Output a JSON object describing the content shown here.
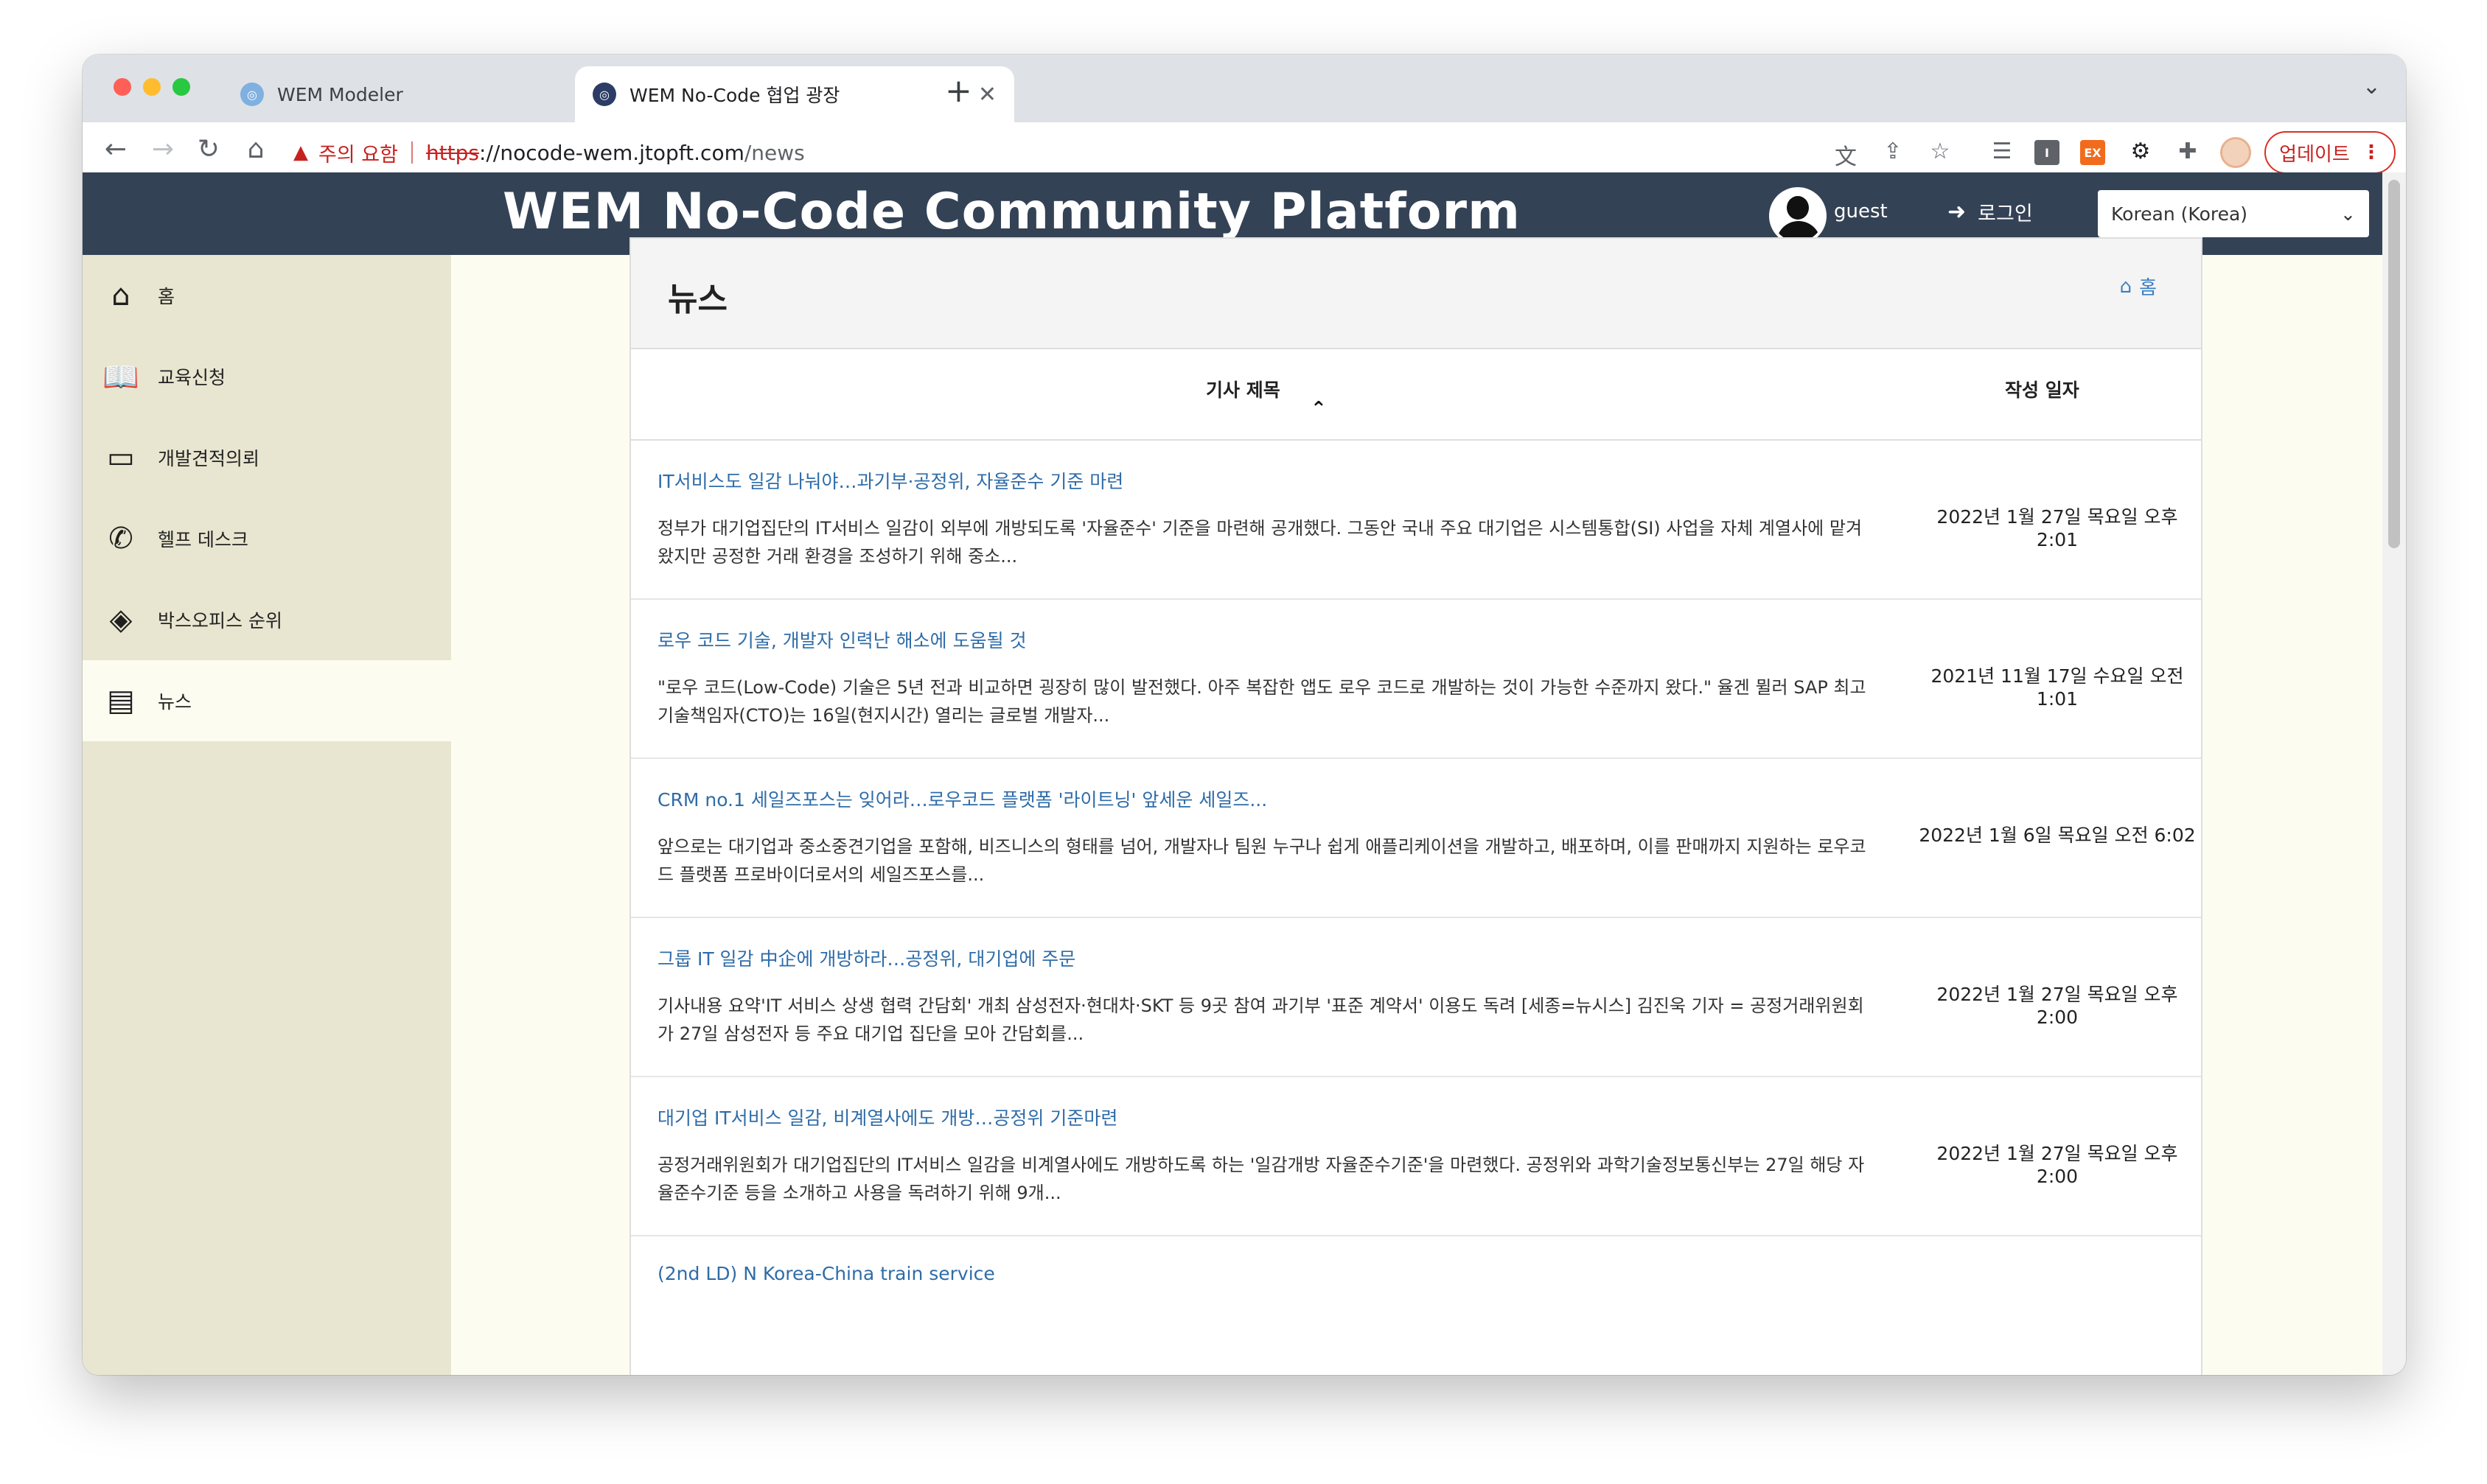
{
  "browser": {
    "tabs": [
      {
        "title": "WEM Modeler",
        "active": false
      },
      {
        "title": "WEM No-Code 협업 광장",
        "active": true
      }
    ],
    "new_tab": "+",
    "tab_menu": "⌄",
    "security_warning": "주의 요함",
    "url": {
      "scheme": "https",
      "host": "://nocode-wem.jtopft.com",
      "path": "/news"
    },
    "update_button": "업데이트",
    "menu_dots": "⋮",
    "extension_labels": {
      "ext1": "I",
      "ext2": "EX"
    }
  },
  "site": {
    "title": "WEM No-Code Community Platform",
    "user_name": "guest",
    "login_label": "로그인",
    "language": "Korean (Korea)"
  },
  "sidebar": {
    "items": [
      {
        "label": "홈",
        "icon": "home-icon"
      },
      {
        "label": "교육신청",
        "icon": "book-icon"
      },
      {
        "label": "개발견적의뢰",
        "icon": "monitor-icon"
      },
      {
        "label": "헬프 데스크",
        "icon": "phone-icon"
      },
      {
        "label": "박스오피스 순위",
        "icon": "ticket-icon"
      },
      {
        "label": "뉴스",
        "icon": "newspaper-icon",
        "active": true
      }
    ]
  },
  "news": {
    "title": "뉴스",
    "breadcrumb": "홈",
    "columns": {
      "title": "기사 제목",
      "date": "작성 일자"
    },
    "rows": [
      {
        "title": "IT서비스도 일감 나눠야…과기부·공정위, 자율준수 기준 마련",
        "summary": "정부가 대기업집단의 IT서비스 일감이 외부에 개방되도록 '자율준수' 기준을 마련해 공개했다. 그동안 국내 주요 대기업은 시스템통합(SI) 사업을 자체 계열사에 맡겨왔지만 공정한 거래 환경을 조성하기 위해 중소...",
        "date": "2022년 1월 27일 목요일 오후 2:01"
      },
      {
        "title": "로우 코드 기술, 개발자 인력난 해소에 도움될 것",
        "summary": "\"로우 코드(Low-Code) 기술은 5년 전과 비교하면 굉장히 많이 발전했다. 아주 복잡한 앱도 로우 코드로 개발하는 것이 가능한 수준까지 왔다.\" 율겐 뮐러 SAP 최고기술책임자(CTO)는 16일(현지시간) 열리는 글로벌 개발자...",
        "date": "2021년 11월 17일 수요일 오전 1:01"
      },
      {
        "title": "CRM no.1 세일즈포스는 잊어라…로우코드 플랫폼 '라이트닝' 앞세운 세일즈...",
        "summary": "앞으로는 대기업과 중소중견기업을 포함해, 비즈니스의 형태를 넘어, 개발자나 팀원 누구나 쉽게 애플리케이션을 개발하고, 배포하며, 이를 판매까지 지원하는 로우코드 플랫폼 프로바이더로서의 세일즈포스를...",
        "date": "2022년 1월 6일 목요일 오전 6:02"
      },
      {
        "title": "그룹 IT 일감 中企에 개방하라…공정위, 대기업에 주문",
        "summary": "기사내용 요약'IT 서비스 상생 협력 간담회' 개최 삼성전자·현대차·SKT 등 9곳 참여 과기부 '표준 계약서' 이용도 독려 [세종=뉴시스] 김진욱 기자 = 공정거래위원회가 27일 삼성전자 등 주요 대기업 집단을 모아 간담회를...",
        "date": "2022년 1월 27일 목요일 오후 2:00"
      },
      {
        "title": "대기업 IT서비스 일감, 비계열사에도 개방…공정위 기준마련",
        "summary": "공정거래위원회가 대기업집단의 IT서비스 일감을 비계열사에도 개방하도록 하는 '일감개방 자율준수기준'을 마련했다. 공정위와 과학기술정보통신부는 27일 해당 자율준수기준 등을 소개하고 사용을 독려하기 위해 9개...",
        "date": "2022년 1월 27일 목요일 오후 2:00"
      },
      {
        "title": "(2nd LD) N Korea-China train service",
        "summary": "",
        "date": ""
      }
    ]
  }
}
